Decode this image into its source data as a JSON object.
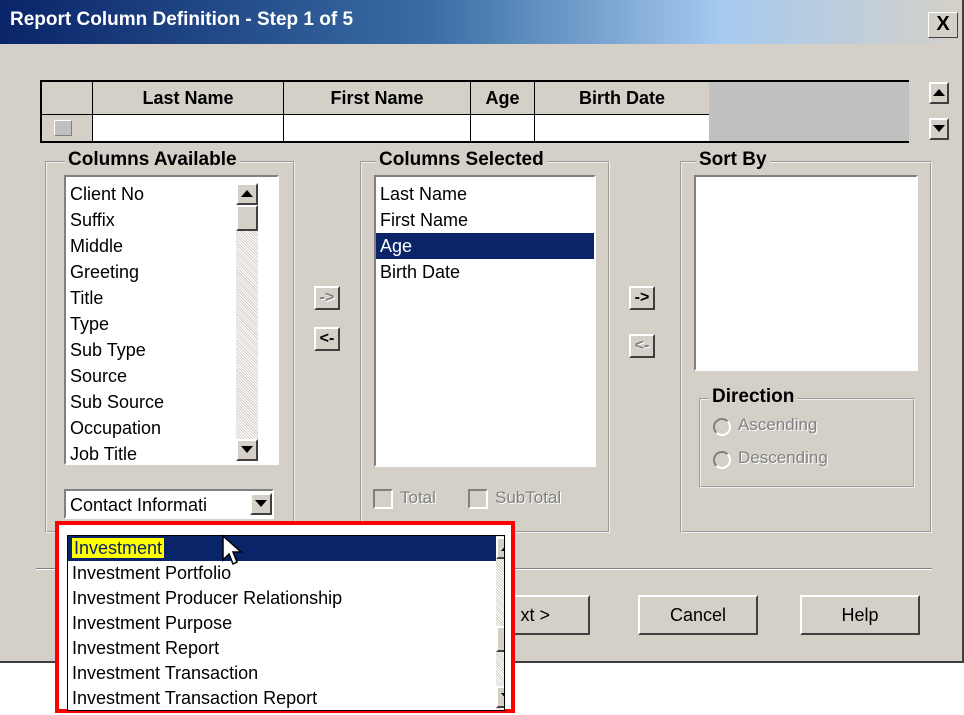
{
  "window": {
    "title": "Report Column Definition - Step 1 of 5",
    "close_label": "X"
  },
  "grid": {
    "headers": [
      "Last Name",
      "First Name",
      "Age",
      "Birth Date"
    ]
  },
  "columns_available": {
    "label": "Columns Available",
    "items": [
      "Client No",
      "Suffix",
      "Middle",
      "Greeting",
      "Title",
      "Type",
      "Sub Type",
      "Source",
      "Sub Source",
      "Occupation",
      "Job Title"
    ],
    "category_value": "Contact Informati"
  },
  "move_buttons": {
    "add": "->",
    "remove": "<-"
  },
  "columns_selected": {
    "label": "Columns Selected",
    "items": [
      "Last Name",
      "First Name",
      "Age",
      "Birth Date"
    ],
    "selected_index": 2,
    "total_label": "Total",
    "subtotal_label": "SubTotal"
  },
  "sort_by": {
    "label": "Sort By",
    "direction_label": "Direction",
    "ascending_label": "Ascending",
    "descending_label": "Descending"
  },
  "buttons": {
    "next": "xt >",
    "cancel": "Cancel",
    "help": "Help"
  },
  "dropdown": {
    "items": [
      "Investment",
      "Investment Portfolio",
      "Investment Producer Relationship",
      "Investment Purpose",
      "Investment Report",
      "Investment Transaction",
      "Investment Transaction Report"
    ],
    "highlighted_index": 0
  },
  "colors": {
    "selection": "#0a246a",
    "highlight_text_bg": "#ffff00",
    "callout_border": "#ff0000",
    "face": "#d4d0c8"
  }
}
